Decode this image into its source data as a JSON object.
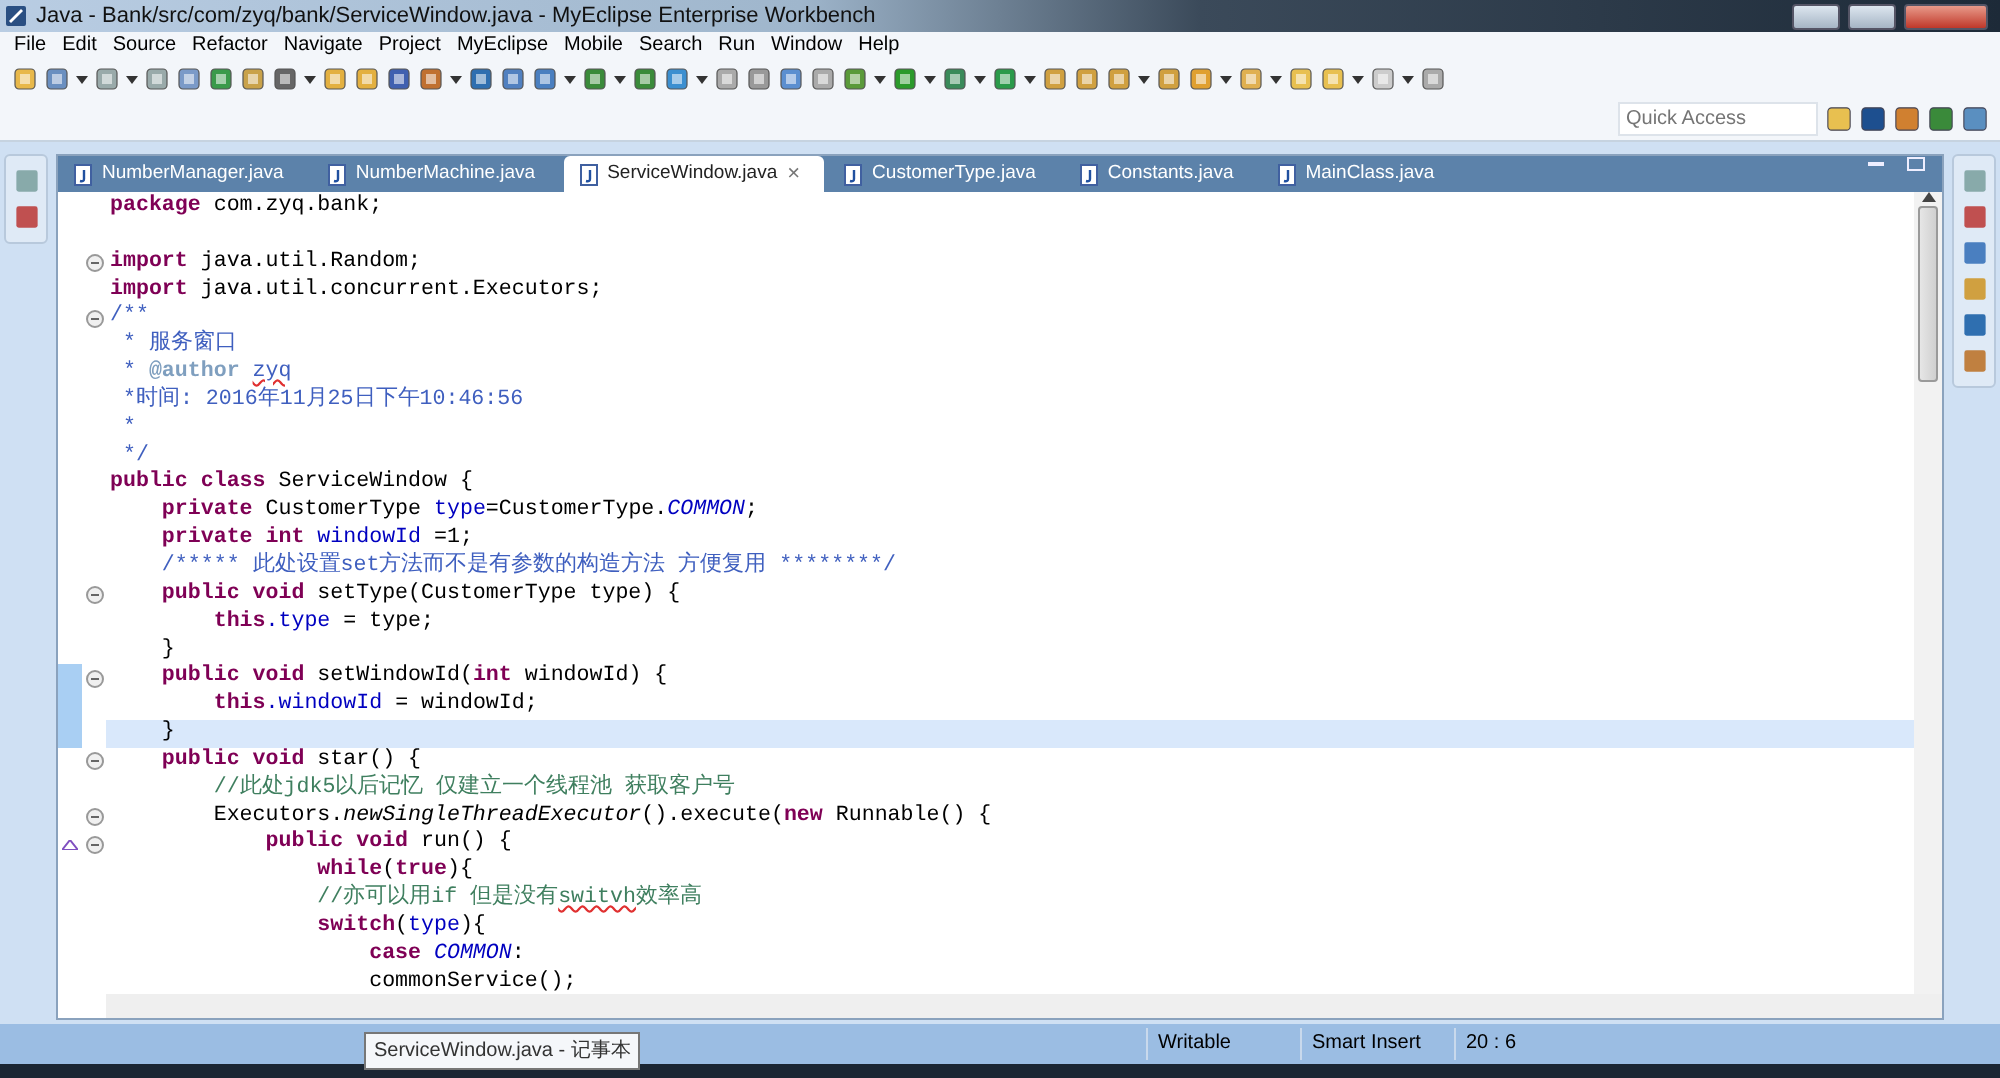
{
  "window": {
    "title": "Java - Bank/src/com/zyq/bank/ServiceWindow.java - MyEclipse Enterprise Workbench"
  },
  "menu": [
    "File",
    "Edit",
    "Source",
    "Refactor",
    "Navigate",
    "Project",
    "MyEclipse",
    "Mobile",
    "Search",
    "Run",
    "Window",
    "Help"
  ],
  "quick_access": {
    "placeholder": "Quick Access"
  },
  "tabs": [
    {
      "label": "NumberManager.java",
      "selected": false
    },
    {
      "label": "NumberMachine.java",
      "selected": false
    },
    {
      "label": "ServiceWindow.java",
      "selected": true
    },
    {
      "label": "CustomerType.java",
      "selected": false
    },
    {
      "label": "Constants.java",
      "selected": false
    },
    {
      "label": "MainClass.java",
      "selected": false
    }
  ],
  "close_glyph": "×",
  "code_lines": [
    {
      "tokens": [
        {
          "kind": "keyword",
          "text": "package"
        },
        {
          "kind": "plain",
          "text": " com.zyq.bank;"
        }
      ],
      "fold": false,
      "changed": false,
      "current": false,
      "override": false
    },
    {
      "kind": "blank"
    },
    {
      "tokens": [
        {
          "kind": "keyword",
          "text": "import"
        },
        {
          "kind": "plain",
          "text": " java.util.Random;"
        }
      ],
      "fold": true,
      "changed": false,
      "current": false,
      "override": false
    },
    {
      "tokens": [
        {
          "kind": "keyword",
          "text": "import"
        },
        {
          "kind": "plain",
          "text": " java.util.concurrent.Executors;"
        }
      ],
      "fold": false,
      "changed": false,
      "current": false,
      "override": false
    },
    {
      "tokens": [
        {
          "kind": "doc",
          "text": "/**"
        }
      ],
      "fold": true,
      "changed": false,
      "current": false,
      "override": false
    },
    {
      "tokens": [
        {
          "kind": "doc",
          "text": " * 服务窗口"
        }
      ],
      "fold": false,
      "changed": false,
      "current": false,
      "override": false
    },
    {
      "tokens": [
        {
          "kind": "doc",
          "text": " * "
        },
        {
          "kind": "doctag",
          "text": "@author "
        },
        {
          "kind": "misspelled-doc",
          "text": "zyq"
        }
      ],
      "fold": false,
      "changed": false,
      "current": false,
      "override": false
    },
    {
      "tokens": [
        {
          "kind": "doc",
          "text": " *时间: 2016年11月25日下午10:46:56"
        }
      ],
      "fold": false,
      "changed": false,
      "current": false,
      "override": false
    },
    {
      "tokens": [
        {
          "kind": "doc",
          "text": " *"
        }
      ],
      "fold": false,
      "changed": false,
      "current": false,
      "override": false
    },
    {
      "tokens": [
        {
          "kind": "doc",
          "text": " */"
        }
      ],
      "fold": false,
      "changed": false,
      "current": false,
      "override": false
    },
    {
      "tokens": [
        {
          "kind": "keyword",
          "text": "public class"
        },
        {
          "kind": "plain",
          "text": " ServiceWindow {"
        }
      ],
      "fold": false,
      "changed": false,
      "current": false,
      "override": false
    },
    {
      "tokens": [
        {
          "kind": "keyword",
          "text": "    private"
        },
        {
          "kind": "plain",
          "text": " CustomerType "
        },
        {
          "kind": "field",
          "text": "type"
        },
        {
          "kind": "plain",
          "text": "=CustomerType."
        },
        {
          "kind": "static",
          "text": "COMMON"
        },
        {
          "kind": "plain",
          "text": ";"
        }
      ],
      "fold": false,
      "changed": false,
      "current": false,
      "override": false
    },
    {
      "tokens": [
        {
          "kind": "keyword",
          "text": "    private int"
        },
        {
          "kind": "field",
          "text": " windowId"
        },
        {
          "kind": "plain",
          "text": " =1;"
        }
      ],
      "fold": false,
      "changed": false,
      "current": false,
      "override": false
    },
    {
      "tokens": [
        {
          "kind": "doc",
          "text": "    /***** 此处设置set方法而不是有参数的构造方法 方便复用 ********/"
        }
      ],
      "fold": false,
      "changed": false,
      "current": false,
      "override": false
    },
    {
      "tokens": [
        {
          "kind": "keyword",
          "text": "    public void"
        },
        {
          "kind": "plain",
          "text": " setType(CustomerType type) {"
        }
      ],
      "fold": true,
      "changed": false,
      "current": false,
      "override": false
    },
    {
      "tokens": [
        {
          "kind": "keyword",
          "text": "        this"
        },
        {
          "kind": "field",
          "text": ".type"
        },
        {
          "kind": "plain",
          "text": " = type;"
        }
      ],
      "fold": false,
      "changed": false,
      "current": false,
      "override": false
    },
    {
      "tokens": [
        {
          "kind": "plain",
          "text": "    }"
        }
      ],
      "fold": false,
      "changed": false,
      "current": false,
      "override": false
    },
    {
      "tokens": [
        {
          "kind": "keyword",
          "text": "    public void"
        },
        {
          "kind": "plain",
          "text": " setWindowId("
        },
        {
          "kind": "keyword",
          "text": "int"
        },
        {
          "kind": "plain",
          "text": " windowId) {"
        }
      ],
      "fold": true,
      "changed": true,
      "current": false,
      "override": false
    },
    {
      "tokens": [
        {
          "kind": "keyword",
          "text": "        this"
        },
        {
          "kind": "field",
          "text": ".windowId"
        },
        {
          "kind": "plain",
          "text": " = windowId;"
        }
      ],
      "fold": false,
      "changed": true,
      "current": false,
      "override": false
    },
    {
      "tokens": [
        {
          "kind": "plain",
          "text": "    }"
        }
      ],
      "fold": false,
      "changed": true,
      "current": true,
      "override": false
    },
    {
      "tokens": [
        {
          "kind": "keyword",
          "text": "    public void"
        },
        {
          "kind": "plain",
          "text": " star() {"
        }
      ],
      "fold": true,
      "changed": false,
      "current": false,
      "override": false
    },
    {
      "tokens": [
        {
          "kind": "comment",
          "text": "        //此处jdk5以后记忆 仅建立一个线程池 获取客户号"
        }
      ],
      "fold": false,
      "changed": false,
      "current": false,
      "override": false
    },
    {
      "tokens": [
        {
          "kind": "plain",
          "text": "        Executors."
        },
        {
          "kind": "static-method",
          "text": "newSingleThreadExecutor"
        },
        {
          "kind": "plain",
          "text": "().execute("
        },
        {
          "kind": "keyword",
          "text": "new"
        },
        {
          "kind": "plain",
          "text": " Runnable() {"
        }
      ],
      "fold": true,
      "changed": false,
      "current": false,
      "override": false
    },
    {
      "tokens": [
        {
          "kind": "keyword",
          "text": "            public void"
        },
        {
          "kind": "plain",
          "text": " run() {"
        }
      ],
      "fold": true,
      "changed": false,
      "current": false,
      "override": true
    },
    {
      "tokens": [
        {
          "kind": "keyword",
          "text": "                while"
        },
        {
          "kind": "plain",
          "text": "("
        },
        {
          "kind": "keyword",
          "text": "true"
        },
        {
          "kind": "plain",
          "text": "){"
        }
      ],
      "fold": false,
      "changed": false,
      "current": false,
      "override": false
    },
    {
      "tokens": [
        {
          "kind": "comment",
          "text": "                //亦可以用if 但是没有"
        },
        {
          "kind": "misspelled-comment",
          "text": "switvh"
        },
        {
          "kind": "comment",
          "text": "效率高"
        }
      ],
      "fold": false,
      "changed": false,
      "current": false,
      "override": false
    },
    {
      "tokens": [
        {
          "kind": "keyword",
          "text": "                switch"
        },
        {
          "kind": "plain",
          "text": "("
        },
        {
          "kind": "field",
          "text": "type"
        },
        {
          "kind": "plain",
          "text": "){"
        }
      ],
      "fold": false,
      "changed": false,
      "current": false,
      "override": false
    },
    {
      "tokens": [
        {
          "kind": "keyword",
          "text": "                    case"
        },
        {
          "kind": "static",
          "text": " COMMON"
        },
        {
          "kind": "plain",
          "text": ":"
        }
      ],
      "fold": false,
      "changed": false,
      "current": false,
      "override": false
    },
    {
      "tokens": [
        {
          "kind": "plain",
          "text": "                    commonService();"
        }
      ],
      "fold": false,
      "changed": false,
      "current": false,
      "override": false
    }
  ],
  "status_bar": [
    "Writable",
    "Smart Insert",
    "20 : 6"
  ],
  "tooltip": "ServiceWindow.java - 记事本"
}
